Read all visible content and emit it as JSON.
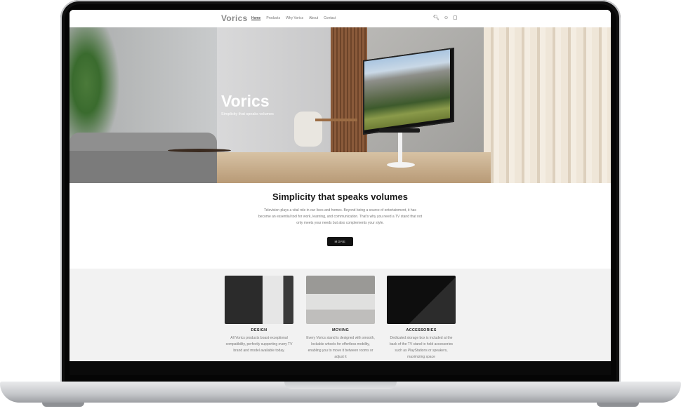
{
  "site": {
    "logo": "Vorics",
    "nav": [
      "Home",
      "Products",
      "Why Vorics",
      "About",
      "Contact"
    ],
    "active_nav": "Home",
    "header_icons": [
      "search-icon",
      "account-icon",
      "cart-icon"
    ]
  },
  "hero": {
    "title": "Vorics",
    "subtitle": "Simplicity that speaks volumes"
  },
  "intro": {
    "title": "Simplicity that speaks volumes",
    "body": "Television plays a vital role in our lives and homes. Beyond being a source of entertainment, it has become an essential tool for work, learning, and communication. That's why you need a TV stand that not only meets your needs but also complements your style.",
    "button": "MORE"
  },
  "features": [
    {
      "title": "DESIGN",
      "text": "All Vorics products boast exceptional compatibility, perfectly supporting every TV brand and model available today."
    },
    {
      "title": "MOVING",
      "text": "Every Vorics stand is designed with smooth, lockable wheels for effortless mobility, enabling you to move it between rooms or adjust it"
    },
    {
      "title": "ACCESSORIES",
      "text": "Dedicated storage box is included at the back of the TV stand to hold accessories such as PlayStations or speakers, maximizing space"
    }
  ],
  "colors": {
    "button_bg": "#121212",
    "features_bg": "#f2f2f2",
    "heading": "#1a1a1a"
  }
}
